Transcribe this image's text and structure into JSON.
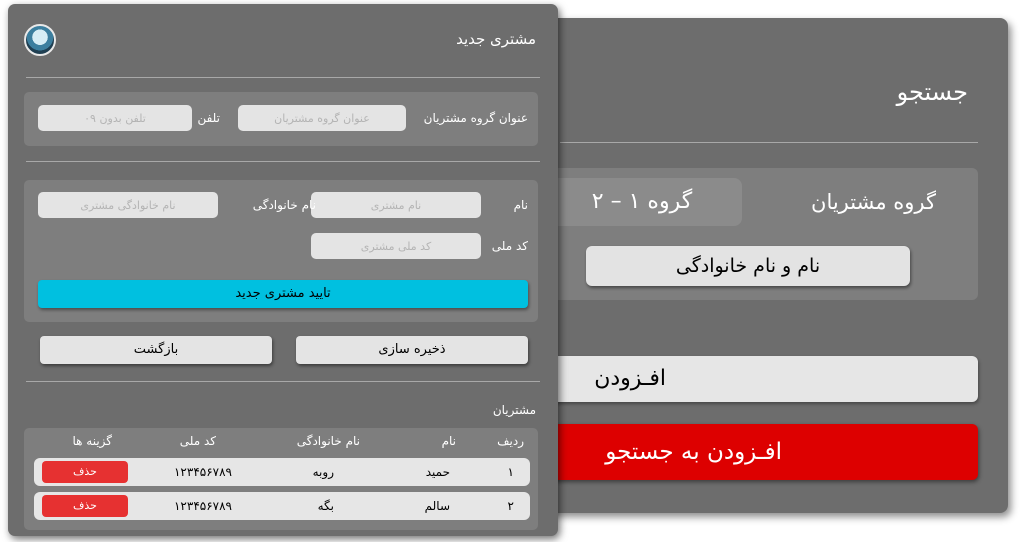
{
  "search_panel": {
    "title": "جستجو",
    "group_label": "گروه مشتریان",
    "group_value": "گروه ۱ – ۲",
    "name_button": "نام و نام خانوادگی",
    "add_button": "افـزودن ",
    "add_to_search_button": "افـزودن به جستجو"
  },
  "new_customer": {
    "title": "مشتری جدید",
    "group_title_label": "عنوان گروه مشتریان",
    "group_title_placeholder": "عنوان گروه مشتریان",
    "phone_label": "تلفن",
    "phone_placeholder": "تلفن بدون ۰۹",
    "first_name_label": "نام",
    "first_name_placeholder": "نام مشتری",
    "last_name_label": "نام خانوادگی",
    "last_name_placeholder": "نام خانوادگی مشتری",
    "national_code_label": "کد ملی",
    "national_code_placeholder": "کد ملی مشتری",
    "confirm_button": "تایید مشتری جدید",
    "save_button": "ذخیره سازی",
    "back_button": "بازگشت"
  },
  "customers": {
    "section_title": "مشتریان",
    "columns": [
      "ردیف",
      "نام",
      "نام خانوادگی",
      "کد ملی",
      "گزینه ها"
    ],
    "rows": [
      {
        "index": "۱",
        "first_name": "حمید",
        "last_name": "روبه",
        "national_code": "۱۲۳۴۵۶۷۸۹",
        "action": "حذف"
      },
      {
        "index": "۲",
        "first_name": "سالم",
        "last_name": "بگه",
        "national_code": "۱۲۳۴۵۶۷۸۹",
        "action": "حذف"
      }
    ]
  },
  "colors": {
    "panel": "#6d6d6d",
    "box": "#7e7e7e",
    "confirm": "#00c0e0",
    "danger": "#dd0000",
    "delete": "#e63131"
  }
}
